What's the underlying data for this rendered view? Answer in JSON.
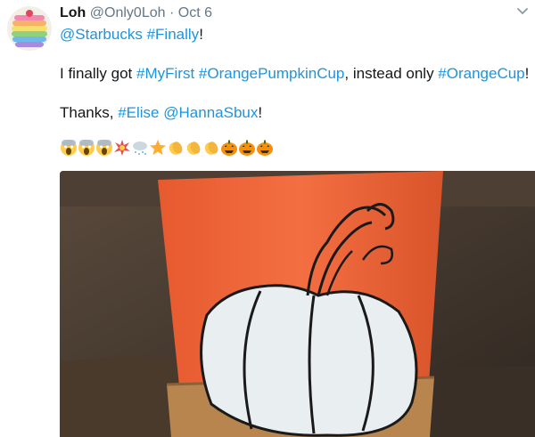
{
  "tweet": {
    "author_name": "Loh",
    "author_handle": "@Only0Loh",
    "separator": "·",
    "date": "Oct 6",
    "reply_line": {
      "mention": "@Starbucks",
      "hashtag": "#Finally",
      "suffix": "!"
    },
    "body_line": {
      "prefix": "I finally got ",
      "hashtag1": "#MyFirst",
      "hashtag2": "#OrangePumpkinCup",
      "middle": ", instead only ",
      "hashtag3": "#OrangeCup",
      "suffix": "!"
    },
    "thanks_line": {
      "prefix": "Thanks, ",
      "hashtag": "#Elise",
      "mention": "@HannaSbux",
      "suffix": "!"
    },
    "emoji_names": [
      "scream",
      "scream",
      "scream",
      "collision",
      "cloud-snow",
      "star",
      "clap",
      "clap",
      "clap",
      "jack-o-lantern",
      "jack-o-lantern",
      "jack-o-lantern"
    ]
  },
  "colors": {
    "link": "#1b95e0",
    "meta": "#657786",
    "cup": "#f26a3d"
  }
}
